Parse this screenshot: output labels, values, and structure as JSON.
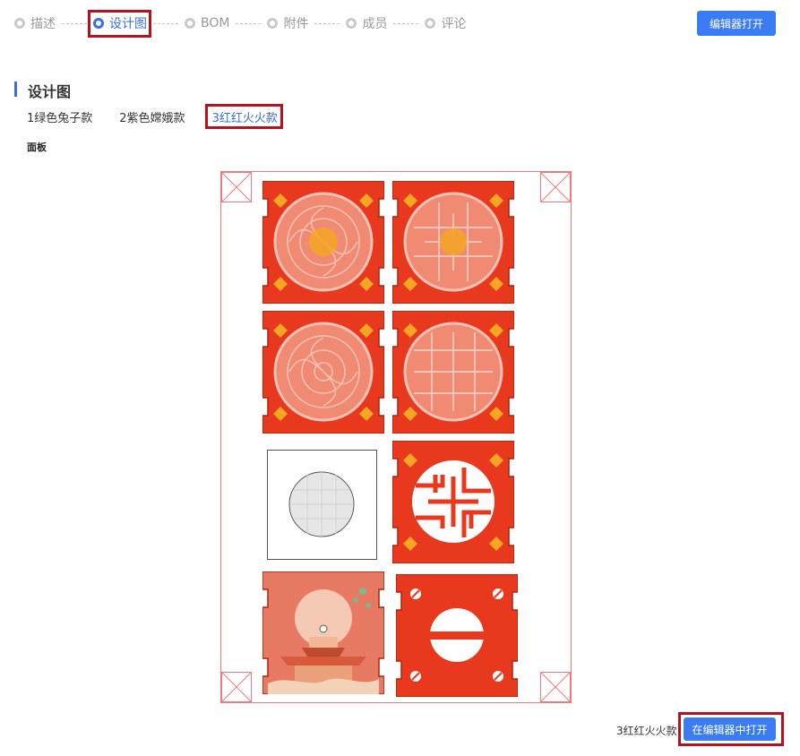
{
  "steps": [
    {
      "label": "描述"
    },
    {
      "label": "设计图"
    },
    {
      "label": "BOM"
    },
    {
      "label": "附件"
    },
    {
      "label": "成员"
    },
    {
      "label": "评论"
    }
  ],
  "active_step": "设计图",
  "header": {
    "open_editor_label": "编辑器打开"
  },
  "section": {
    "title": "设计图"
  },
  "variants": [
    {
      "label": "1绿色兔子款"
    },
    {
      "label": "2紫色嫦娥款"
    },
    {
      "label": "3红红火火款"
    }
  ],
  "active_variant": "3红红火火款",
  "panel_label": "面板",
  "footer": {
    "variant_name": "3红红火火款",
    "open_in_editor_label": "在编辑器中打开"
  },
  "colors": {
    "accent": "#3a7cf4",
    "highlight": "#b3121f",
    "panel_red": "#e8381d",
    "ornament_orange": "#f5a623"
  },
  "icons": {
    "corner_mark": "crossed-box-icon"
  }
}
